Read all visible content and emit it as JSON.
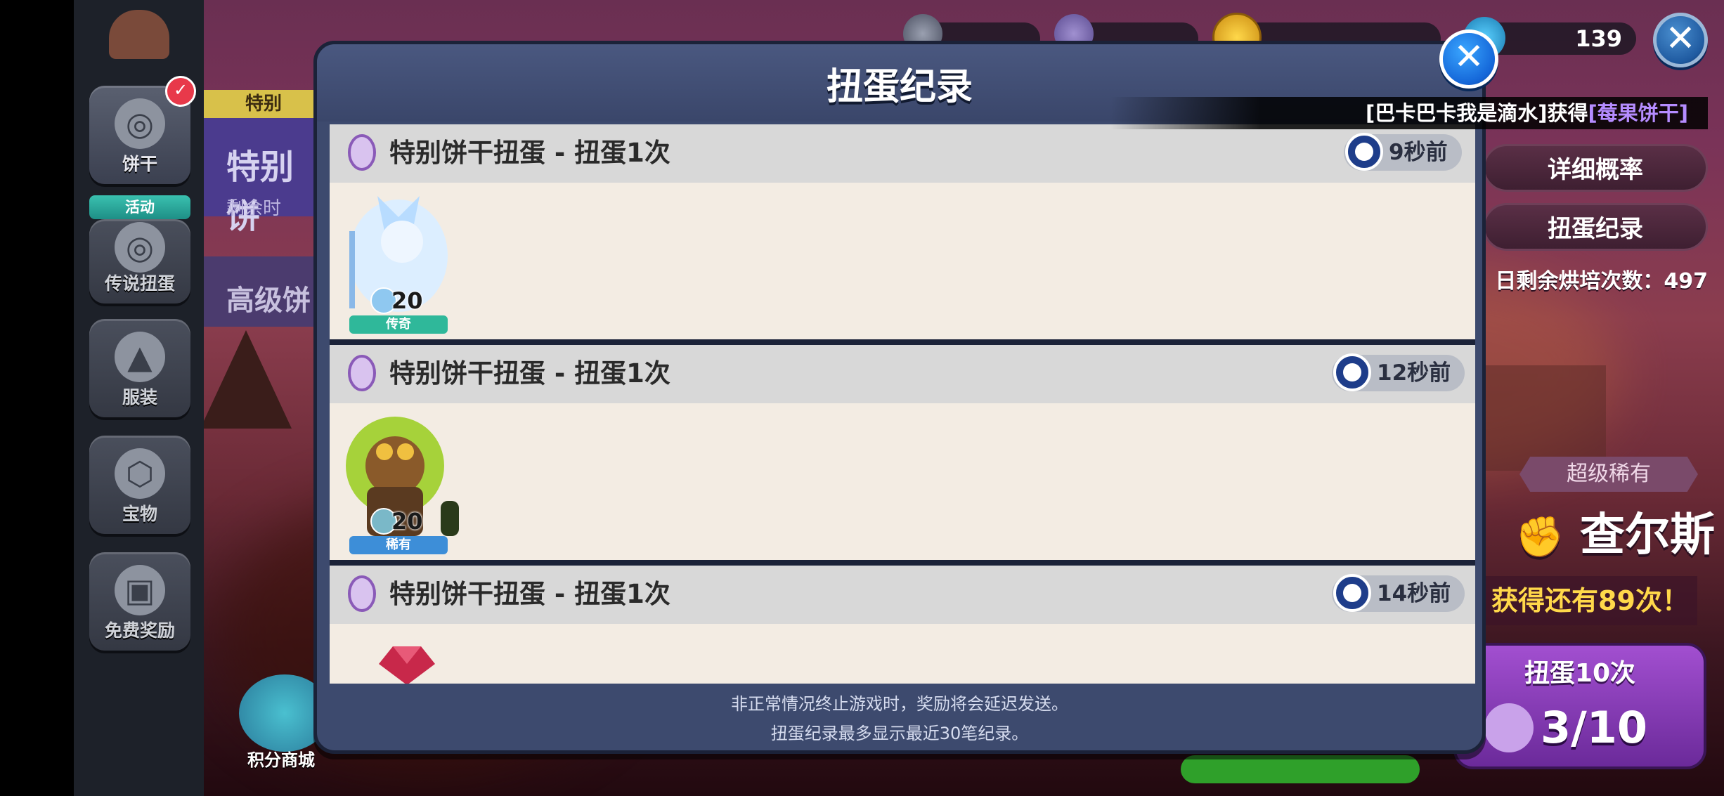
{
  "nav": {
    "items": [
      {
        "label": "饼干",
        "badge": "活动"
      },
      {
        "label": "传说扭蛋"
      },
      {
        "label": "服装"
      },
      {
        "label": "宝物"
      },
      {
        "label": "免费奖励"
      }
    ],
    "shop_label": "积分商城"
  },
  "behind": {
    "tab_label": "特别",
    "title": "特别饼",
    "remaining": "剩余时",
    "advanced": "高级饼"
  },
  "currency": {
    "crystals": "139"
  },
  "ticker": {
    "player": "[巴卡巴卡我是滴水]获得",
    "item": "[莓果饼干]"
  },
  "side": {
    "detail_rate": "详细概率",
    "gacha_log": "扭蛋纪录",
    "bake_remaining": "日剩余烘培次数：497",
    "rarity": "超级稀有",
    "character": "查尔斯",
    "pity": "获得还有89次！",
    "pull10_label": "扭蛋10次",
    "pull10_count": "3/10"
  },
  "modal": {
    "title": "扭蛋纪录",
    "records": [
      {
        "title": "特别饼干扭蛋 - 扭蛋1次",
        "time": "9秒前",
        "level": "20",
        "rarity": "传奇",
        "rarity_color": "#2fb89a"
      },
      {
        "title": "特别饼干扭蛋 - 扭蛋1次",
        "time": "12秒前",
        "level": "20",
        "rarity": "稀有",
        "rarity_color": "#3d8ed8"
      },
      {
        "title": "特别饼干扭蛋 - 扭蛋1次",
        "time": "14秒前"
      }
    ],
    "footer_line1": "非正常情况终止游戏时，奖励将会延迟发送。",
    "footer_line2": "扭蛋纪录最多显示最近30笔纪录。"
  }
}
